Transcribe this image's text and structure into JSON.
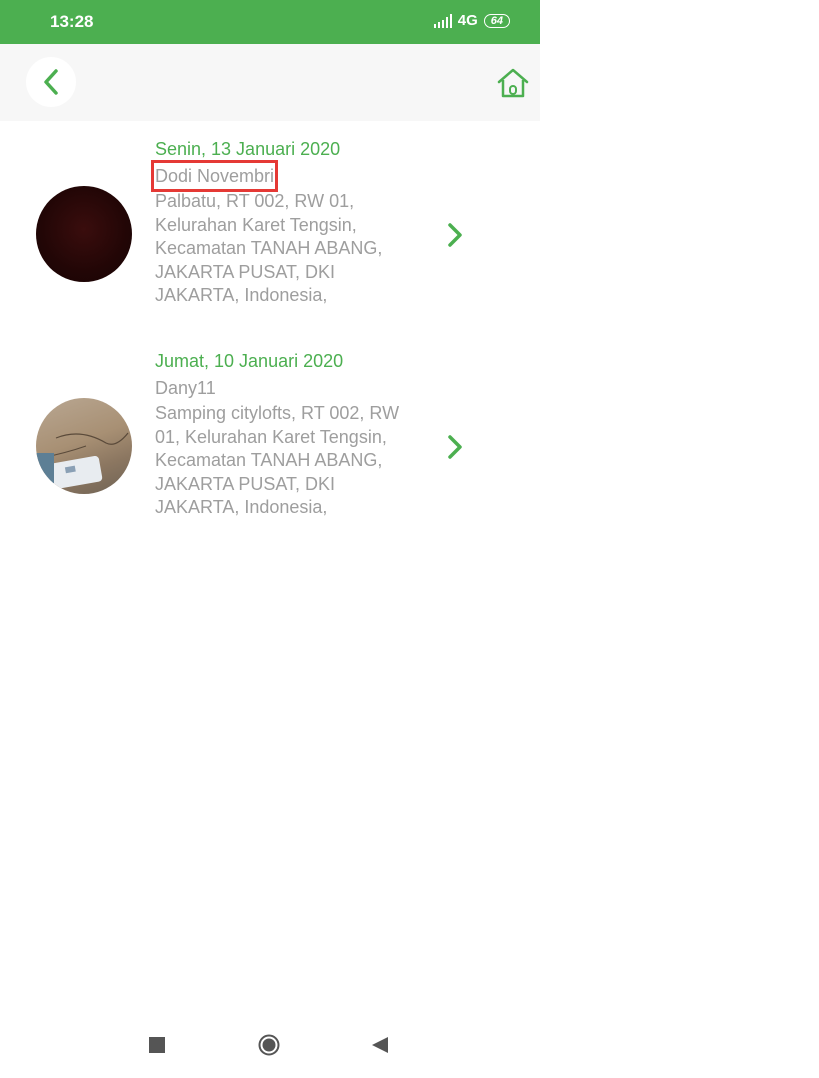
{
  "status_bar": {
    "time": "13:28",
    "network": "4G",
    "battery": "64"
  },
  "app_bar": {
    "back_icon": "chevron-left-icon",
    "home_icon": "home-icon"
  },
  "items": [
    {
      "date": "Senin, 13 Januari 2020",
      "name": "Dodi Novembri",
      "address": "Palbatu, RT 002, RW 01, Kelurahan Karet Tengsin, Kecamatan TANAH ABANG, JAKARTA PUSAT, DKI JAKARTA, Indonesia,"
    },
    {
      "date": "Jumat, 10 Januari 2020",
      "name": "Dany11",
      "address": "Samping citylofts, RT 002, RW 01, Kelurahan Karet Tengsin, Kecamatan TANAH ABANG, JAKARTA PUSAT, DKI JAKARTA, Indonesia,"
    }
  ],
  "colors": {
    "accent": "#4caf50",
    "muted_text": "#9e9e9e",
    "highlight": "#e53935"
  }
}
